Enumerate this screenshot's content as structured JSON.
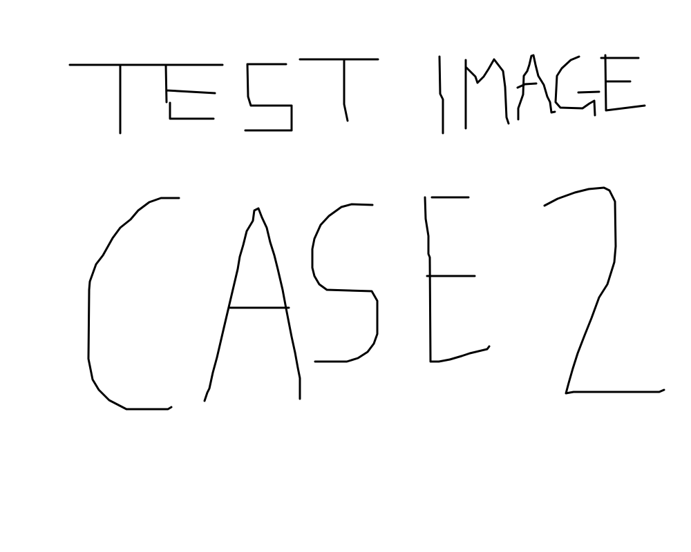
{
  "drawing": {
    "line_1": "TEST IMAGE",
    "line_2": "CASE 2",
    "ink_color": "#000000",
    "background_color": "#ffffff"
  }
}
